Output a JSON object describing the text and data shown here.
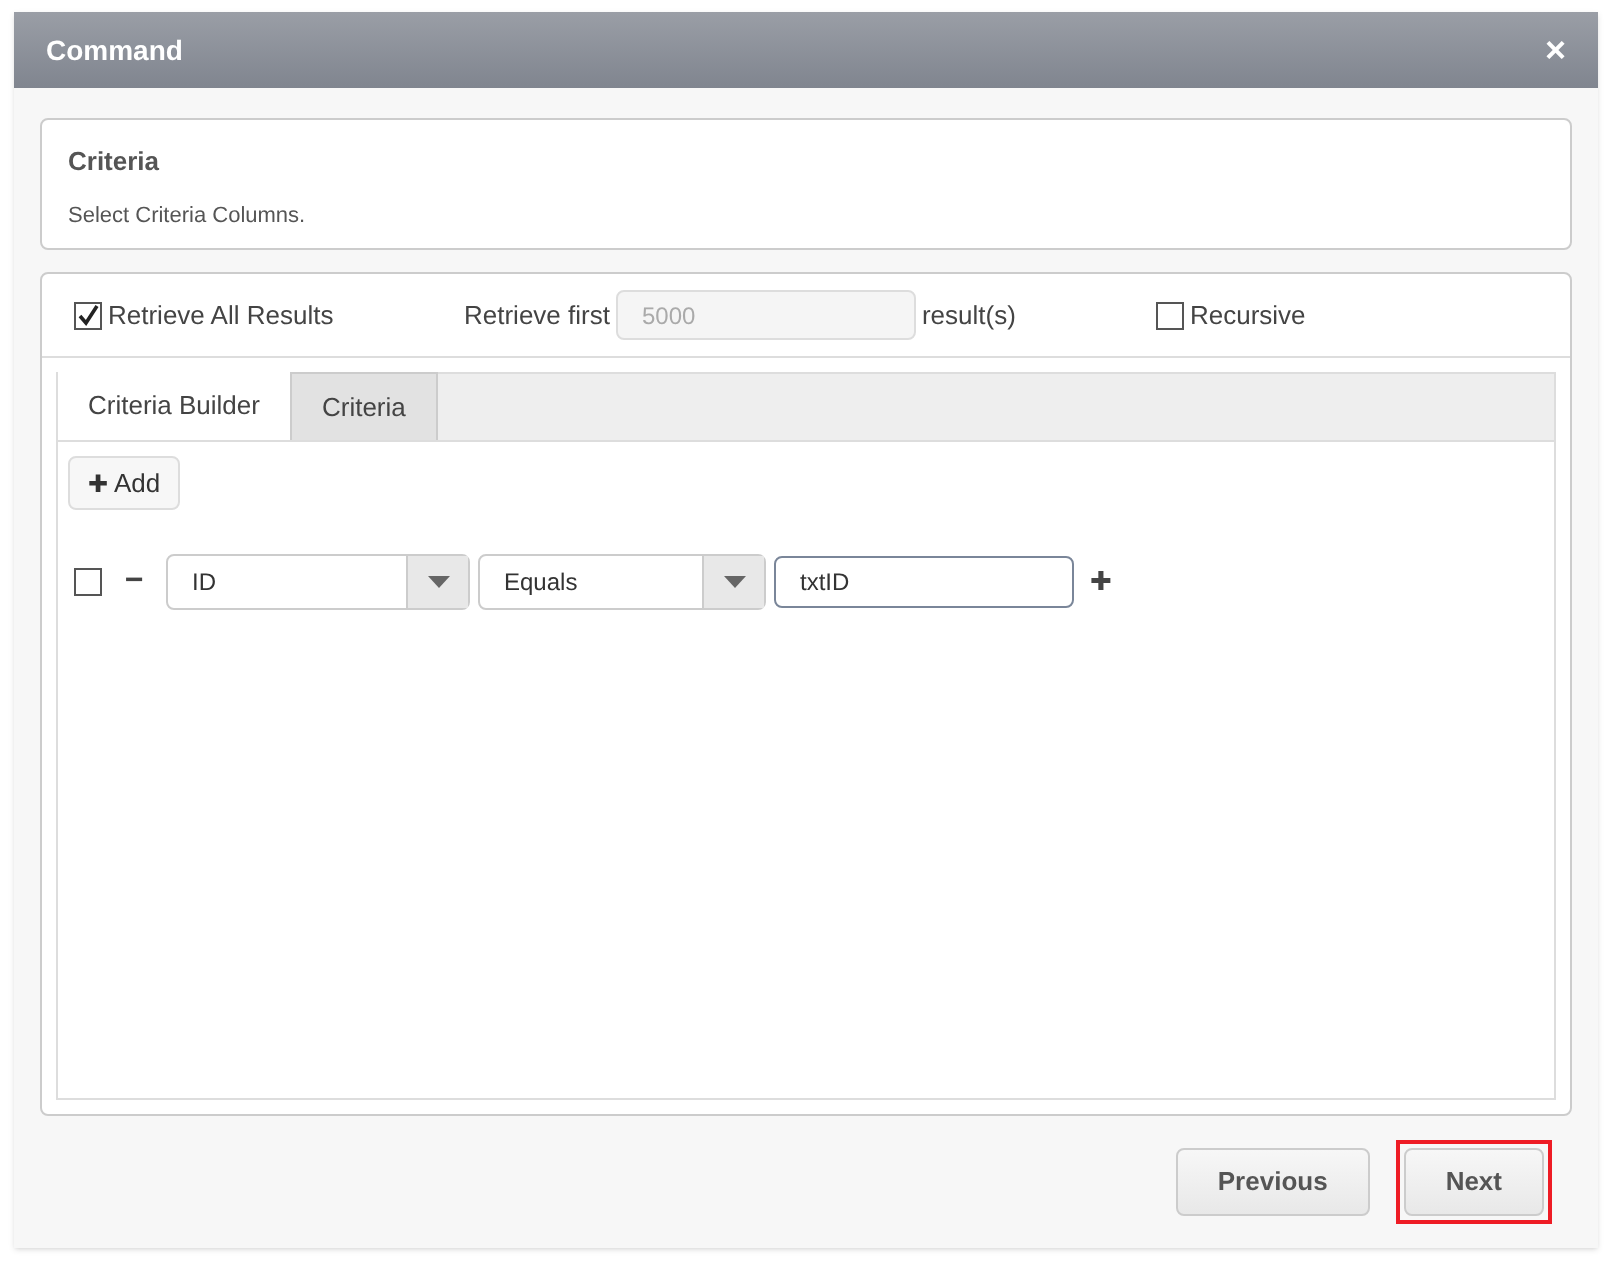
{
  "window": {
    "title": "Command",
    "close": "×"
  },
  "header_card": {
    "title": "Criteria",
    "subtitle": "Select Criteria Columns."
  },
  "options": {
    "retrieve_all": {
      "label": "Retrieve All Results",
      "checked": true
    },
    "retrieve_first_label": "Retrieve first",
    "retrieve_first": {
      "placeholder": "5000",
      "disabled": true
    },
    "results_suffix": "result(s)",
    "recursive": {
      "label": "Recursive",
      "checked": false
    }
  },
  "tabs": [
    {
      "label": "Criteria Builder",
      "selected": true
    },
    {
      "label": "Criteria",
      "selected": false
    }
  ],
  "add_button": {
    "icon": "✚",
    "label": "Add"
  },
  "criteria_rows": [
    {
      "checked": false,
      "remove": "−",
      "column": "ID",
      "operator": "Equals",
      "value": "txtID",
      "add": "✚"
    }
  ],
  "footer": {
    "buttons": [
      {
        "label": "Previous",
        "highlighted": false
      },
      {
        "label": "Next",
        "highlighted": true
      }
    ]
  }
}
